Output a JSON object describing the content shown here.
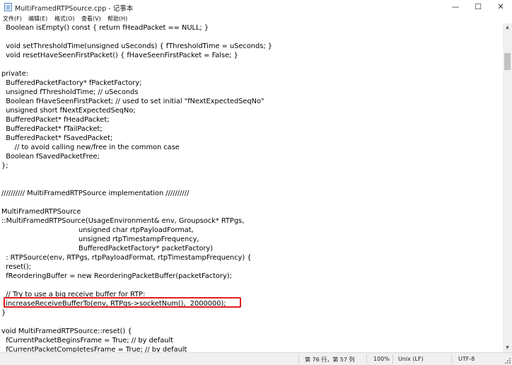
{
  "window": {
    "title": "MultiFramedRTPSource.cpp - 记事本",
    "minimize_glyph": "—",
    "maximize_glyph": "☐",
    "close_glyph": "✕"
  },
  "menu": [
    {
      "label": "文件(F)"
    },
    {
      "label": "编辑(E)"
    },
    {
      "label": "格式(O)"
    },
    {
      "label": "查看(V)"
    },
    {
      "label": "帮助(H)"
    }
  ],
  "code_lines": [
    "  Boolean isEmpty() const { return fHeadPacket == NULL; }",
    "",
    "  void setThresholdTime(unsigned uSeconds) { fThresholdTime = uSeconds; }",
    "  void resetHaveSeenFirstPacket() { fHaveSeenFirstPacket = False; }",
    "",
    "private:",
    "  BufferedPacketFactory* fPacketFactory;",
    "  unsigned fThresholdTime; // uSeconds",
    "  Boolean fHaveSeenFirstPacket; // used to set initial \"fNextExpectedSeqNo\"",
    "  unsigned short fNextExpectedSeqNo;",
    "  BufferedPacket* fHeadPacket;",
    "  BufferedPacket* fTailPacket;",
    "  BufferedPacket* fSavedPacket;",
    "      // to avoid calling new/free in the common case",
    "  Boolean fSavedPacketFree;",
    "};",
    "",
    "",
    "////////// MultiFramedRTPSource implementation //////////",
    "",
    "MultiFramedRTPSource",
    "::MultiFramedRTPSource(UsageEnvironment& env, Groupsock* RTPgs,",
    "                                   unsigned char rtpPayloadFormat,",
    "                                   unsigned rtpTimestampFrequency,",
    "                                   BufferedPacketFactory* packetFactory)",
    "  : RTPSource(env, RTPgs, rtpPayloadFormat, rtpTimestampFrequency) {",
    "  reset();",
    "  fReorderingBuffer = new ReorderingPacketBuffer(packetFactory);",
    "",
    "  // Try to use a big receive buffer for RTP:",
    "  increaseReceiveBufferTo(env, RTPgs->socketNum(),  2000000);",
    "}",
    "",
    "void MultiFramedRTPSource::reset() {",
    "  fCurrentPacketBeginsFrame = True; // by default",
    "  fCurrentPacketCompletesFrame = True; // by default"
  ],
  "status": {
    "position": "第 76 行，第 57 列",
    "zoom": "100%",
    "line_ending": "Unix (LF)",
    "encoding": "UTF-8"
  },
  "colors": {
    "highlight_border": "#e02020"
  }
}
